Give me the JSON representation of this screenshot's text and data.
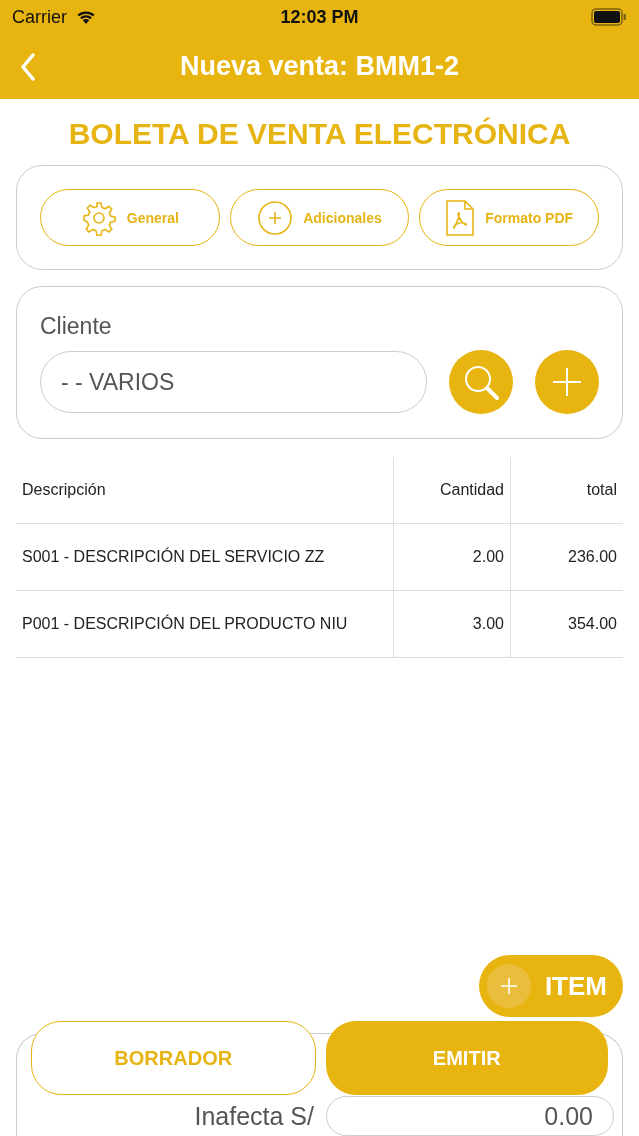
{
  "status_bar": {
    "carrier": "Carrier",
    "time": "12:03 PM"
  },
  "nav": {
    "title": "Nueva venta: BMM1-2"
  },
  "heading": "BOLETA DE VENTA ELECTRÓNICA",
  "option_buttons": [
    {
      "label": "General",
      "kind": "gear"
    },
    {
      "label": "Adicionales",
      "kind": "plus"
    },
    {
      "label": "Formato PDF",
      "kind": "pdf"
    }
  ],
  "client": {
    "label": "Cliente",
    "value": "- - VARIOS"
  },
  "table": {
    "columns": [
      "Descripción",
      "Cantidad",
      "total"
    ],
    "rows": [
      [
        "S001 - DESCRIPCIÓN DEL SERVICIO ZZ",
        "2.00",
        "236.00"
      ],
      [
        "P001 - DESCRIPCIÓN DEL PRODUCTO NIU",
        "3.00",
        "354.00"
      ]
    ]
  },
  "item_button": {
    "label": "ITEM"
  },
  "actions": [
    {
      "label": "BORRADOR",
      "kind": "outline"
    },
    {
      "label": "EMITIR",
      "kind": "filled"
    }
  ],
  "totals": [
    {
      "label": "Inafecta S/",
      "value": "0.00"
    }
  ]
}
